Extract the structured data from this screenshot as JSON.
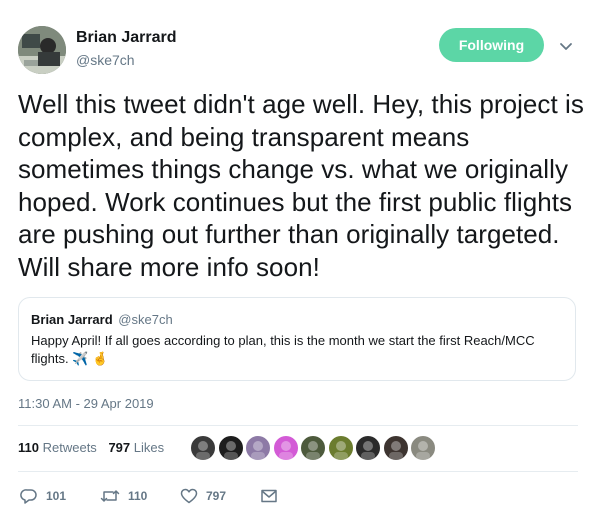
{
  "author": {
    "display_name": "Brian Jarrard",
    "handle": "@ske7ch",
    "avatar_icon": "user-avatar"
  },
  "follow_button": {
    "label": "Following",
    "color": "#5cd6a6"
  },
  "more_menu_icon": "chevron-down-icon",
  "tweet": {
    "text": "Well this tweet didn't age well. Hey, this project is complex, and being transparent means sometimes things change vs. what we originally hoped. Work continues but the first public flights are pushing out further than originally targeted. Will share more info soon!"
  },
  "quoted_tweet": {
    "display_name": "Brian Jarrard",
    "handle": "@ske7ch",
    "text": "Happy April! If all goes according to plan, this is the month we start the first Reach/MCC flights. ✈️ 🤞"
  },
  "timestamp": "11:30 AM - 29 Apr 2019",
  "stats": {
    "retweets_count": "110",
    "retweets_label": "Retweets",
    "likes_count": "797",
    "likes_label": "Likes"
  },
  "likers": [
    {
      "name": "liker-avatar-1",
      "color": "#3a3a3a"
    },
    {
      "name": "liker-avatar-2",
      "color": "#1d1d1d"
    },
    {
      "name": "liker-avatar-3",
      "color": "#8d7aa6"
    },
    {
      "name": "liker-avatar-4",
      "color": "#d35bd6"
    },
    {
      "name": "liker-avatar-5",
      "color": "#4d5a3c"
    },
    {
      "name": "liker-avatar-6",
      "color": "#6b7c2e"
    },
    {
      "name": "liker-avatar-7",
      "color": "#2b2b2b"
    },
    {
      "name": "liker-avatar-8",
      "color": "#3d3430"
    },
    {
      "name": "liker-avatar-9",
      "color": "#8a8a80"
    }
  ],
  "actions": {
    "reply_count": "101",
    "retweet_count": "110",
    "like_count": "797"
  }
}
